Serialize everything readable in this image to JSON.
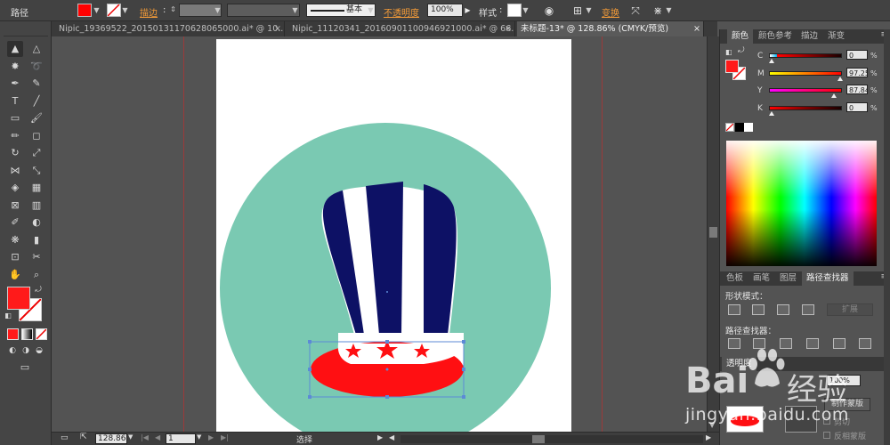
{
  "control_bar": {
    "object_type": "路径",
    "fill_color": "#ff0000",
    "stroke_label": "描边",
    "stroke_style_label": "基本",
    "opacity_label": "不透明度",
    "opacity_value": "100%",
    "style_label": "样式",
    "transform_label": "变换"
  },
  "tabs": [
    {
      "label": "Nipic_19369522_20150131170628065000.ai* @ 10...",
      "close": "×"
    },
    {
      "label": "Nipic_11120341_20160901100946921000.ai* @ 66...",
      "close": "×"
    },
    {
      "label": "未标题-13* @ 128.86% (CMYK/预览)",
      "close": "×"
    }
  ],
  "tools": {
    "icons": [
      "selection-tool-icon",
      "direct-selection-tool-icon",
      "magic-wand-tool-icon",
      "lasso-tool-icon",
      "pen-tool-icon",
      "curvature-tool-icon",
      "type-tool-icon",
      "line-tool-icon",
      "rectangle-tool-icon",
      "paintbrush-tool-icon",
      "pencil-tool-icon",
      "eraser-tool-icon",
      "rotate-tool-icon",
      "scale-tool-icon",
      "width-tool-icon",
      "free-transform-tool-icon",
      "shape-builder-tool-icon",
      "perspective-grid-tool-icon",
      "mesh-tool-icon",
      "gradient-tool-icon",
      "eyedropper-tool-icon",
      "blend-tool-icon",
      "symbol-sprayer-tool-icon",
      "column-graph-tool-icon",
      "artboard-tool-icon",
      "slice-tool-icon",
      "hand-tool-icon",
      "zoom-tool-icon"
    ],
    "fill_color": "#ff1a1a"
  },
  "artwork": {
    "circle_color": "#7ac9b2",
    "hat_blue": "#0d1165",
    "hat_red": "#ff0f12",
    "hat_white": "#ffffff",
    "guide_color": "#9b3a3a"
  },
  "status": {
    "zoom": "128.86",
    "page": "1",
    "tool_label": "选择"
  },
  "color_panel": {
    "tabs": [
      "颜色",
      "颜色参考",
      "描边",
      "渐变"
    ],
    "channels": [
      {
        "name": "C",
        "value": "0",
        "gradient": [
          "#fff",
          "#00aeef"
        ]
      },
      {
        "name": "M",
        "value": "97.25",
        "gradient": [
          "#ffff00",
          "#ff0000"
        ]
      },
      {
        "name": "Y",
        "value": "87.84",
        "gradient": [
          "#ff00ff",
          "#ff0000"
        ]
      },
      {
        "name": "K",
        "value": "0",
        "gradient": [
          "#ff0000",
          "#1a0000"
        ]
      }
    ],
    "percent_symbol": "%"
  },
  "pathfinder_panel": {
    "tabs": [
      "色板",
      "画笔",
      "图层",
      "路径查找器"
    ],
    "shape_modes_label": "形状模式：",
    "expand_label": "扩展",
    "pathfinders_label": "路径查找器："
  },
  "transparency_panel": {
    "title": "透明度",
    "opacity": "100%",
    "make_mask_label": "制作蒙版",
    "clip_label": "剪切",
    "invert_mask_label": "反相蒙版"
  },
  "watermark": {
    "brand": "Bai",
    "brand_cn": "经验",
    "url": "jingyan.baidu.com"
  }
}
